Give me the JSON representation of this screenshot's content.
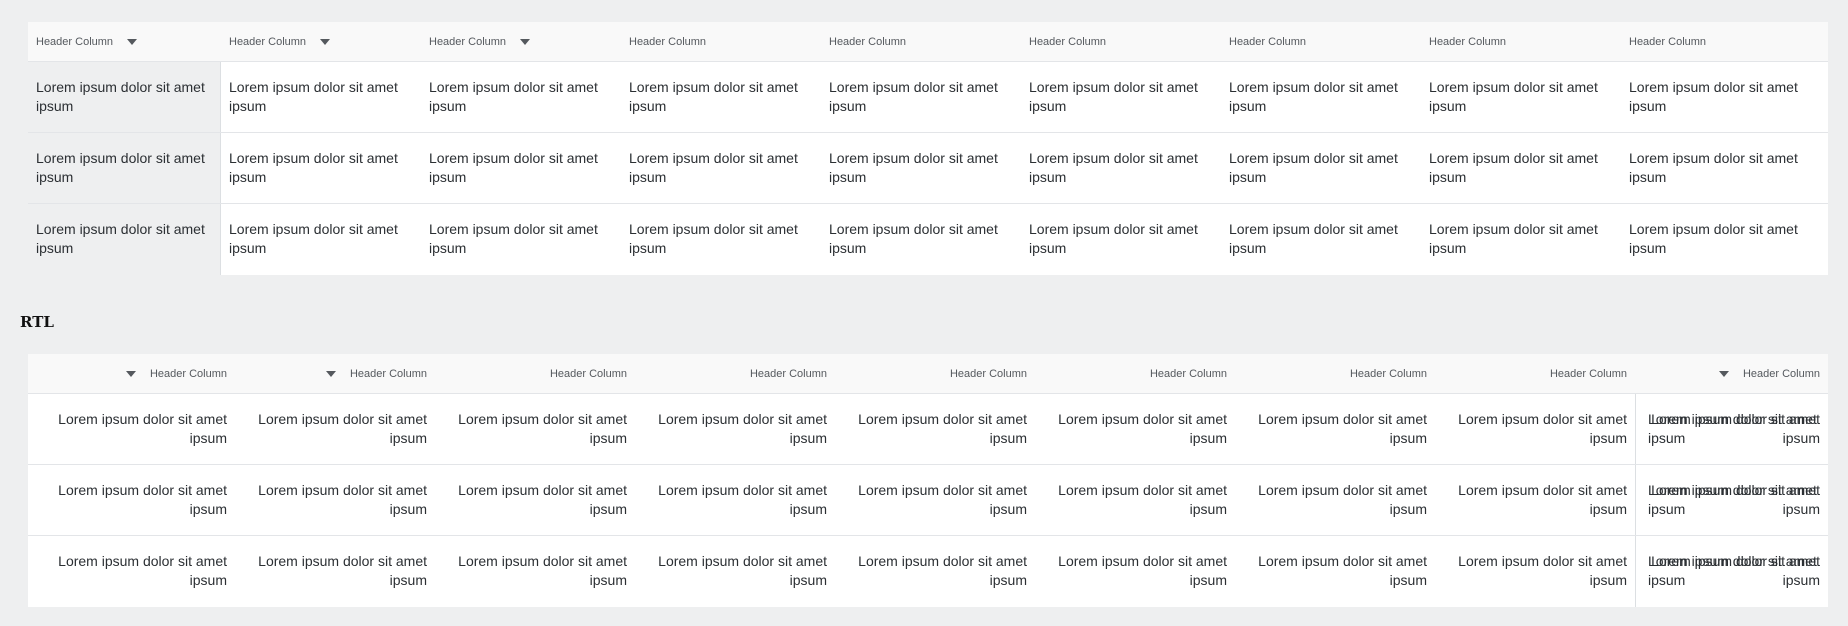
{
  "ltr_grid": {
    "header": [
      {
        "label": "Header Column",
        "sortable": true
      },
      {
        "label": "Header Column",
        "sortable": true
      },
      {
        "label": "Header Column",
        "sortable": true
      },
      {
        "label": "Header Column",
        "sortable": false
      },
      {
        "label": "Header Column",
        "sortable": false
      },
      {
        "label": "Header Column",
        "sortable": false
      },
      {
        "label": "Header Column",
        "sortable": false
      },
      {
        "label": "Header Column",
        "sortable": false
      },
      {
        "label": "Header Column",
        "sortable": false
      }
    ],
    "rows": [
      [
        "Lorem ipsum dolor sit amet ipsum",
        "Lorem ipsum dolor sit amet ipsum",
        "Lorem ipsum dolor sit amet ipsum",
        "Lorem ipsum dolor sit amet ipsum",
        "Lorem ipsum dolor sit amet ipsum",
        "Lorem ipsum dolor sit amet ipsum",
        "Lorem ipsum dolor sit amet ipsum",
        "Lorem ipsum dolor sit amet ipsum",
        "Lorem ipsum dolor sit amet ipsum"
      ],
      [
        "Lorem ipsum dolor sit amet ipsum",
        "Lorem ipsum dolor sit amet ipsum",
        "Lorem ipsum dolor sit amet ipsum",
        "Lorem ipsum dolor sit amet ipsum",
        "Lorem ipsum dolor sit amet ipsum",
        "Lorem ipsum dolor sit amet ipsum",
        "Lorem ipsum dolor sit amet ipsum",
        "Lorem ipsum dolor sit amet ipsum",
        "Lorem ipsum dolor sit amet ipsum"
      ],
      [
        "Lorem ipsum dolor sit amet ipsum",
        "Lorem ipsum dolor sit amet ipsum",
        "Lorem ipsum dolor sit amet ipsum",
        "Lorem ipsum dolor sit amet ipsum",
        "Lorem ipsum dolor sit amet ipsum",
        "Lorem ipsum dolor sit amet ipsum",
        "Lorem ipsum dolor sit amet ipsum",
        "Lorem ipsum dolor sit amet ipsum",
        "Lorem ipsum dolor sit amet ipsum"
      ]
    ]
  },
  "rtl_section": {
    "title": "RTL"
  },
  "rtl_grid": {
    "header": [
      {
        "label": "Header Column",
        "sortable": true
      },
      {
        "label": "Header Column",
        "sortable": false
      },
      {
        "label": "Header Column",
        "sortable": false
      },
      {
        "label": "Header Column",
        "sortable": false
      },
      {
        "label": "Header Column",
        "sortable": false
      },
      {
        "label": "Header Column",
        "sortable": false
      },
      {
        "label": "Header Column",
        "sortable": false
      },
      {
        "label": "Header Column",
        "sortable": true
      },
      {
        "label": "Header Column",
        "sortable": true
      }
    ],
    "rows": [
      [
        "Lorem ipsum dolor sit amet ipsum",
        "Lorem ipsum dolor sit amet ipsum",
        "Lorem ipsum dolor sit amet ipsum",
        "Lorem ipsum dolor sit amet ipsum",
        "Lorem ipsum dolor sit amet ipsum",
        "Lorem ipsum dolor sit amet ipsum",
        "Lorem ipsum dolor sit amet ipsum",
        "Lorem ipsum dolor sit amet ipsum",
        "Lorem ipsum dolor sit amet ipsum"
      ],
      [
        "Lorem ipsum dolor sit amet ipsum",
        "Lorem ipsum dolor sit amet ipsum",
        "Lorem ipsum dolor sit amet ipsum",
        "Lorem ipsum dolor sit amet ipsum",
        "Lorem ipsum dolor sit amet ipsum",
        "Lorem ipsum dolor sit amet ipsum",
        "Lorem ipsum dolor sit amet ipsum",
        "Lorem ipsum dolor sit amet ipsum",
        "Lorem ipsum dolor sit amet ipsum"
      ],
      [
        "Lorem ipsum dolor sit amet ipsum",
        "Lorem ipsum dolor sit amet ipsum",
        "Lorem ipsum dolor sit amet ipsum",
        "Lorem ipsum dolor sit amet ipsum",
        "Lorem ipsum dolor sit amet ipsum",
        "Lorem ipsum dolor sit amet ipsum",
        "Lorem ipsum dolor sit amet ipsum",
        "Lorem ipsum dolor sit amet ipsum",
        "Lorem ipsum dolor sit amet ipsum"
      ]
    ]
  }
}
